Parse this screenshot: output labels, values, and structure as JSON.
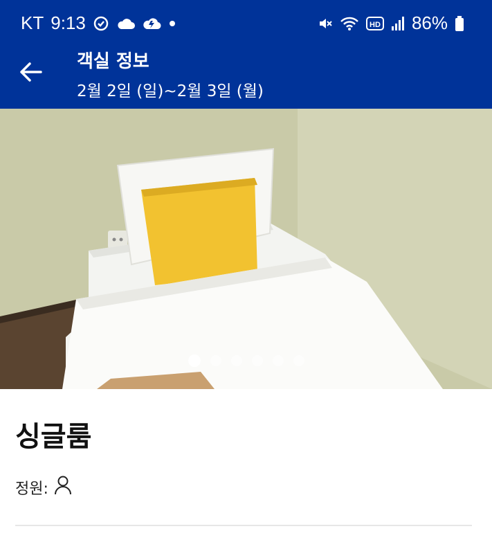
{
  "status_bar": {
    "carrier": "KT",
    "time": "9:13",
    "battery": "86%",
    "icons_left": [
      "sync-icon",
      "cloud-icon",
      "cloud-sync-icon",
      "dot-icon"
    ],
    "icons_right": [
      "mute-icon",
      "wifi-icon",
      "hd-icon",
      "signal-icon",
      "battery-icon"
    ]
  },
  "app_bar": {
    "title": "객실 정보",
    "subtitle": "2월 2일 (일)~2월 3일 (월)",
    "back_icon": "back-arrow-icon"
  },
  "gallery": {
    "image_count": 6,
    "active_index": 0
  },
  "room": {
    "name": "싱글룸",
    "capacity_label": "정원:",
    "capacity_icon": "person-icon"
  },
  "colors": {
    "primary": "#003399",
    "wall": "#c8c9a7",
    "pillow_accent": "#f2c230"
  }
}
